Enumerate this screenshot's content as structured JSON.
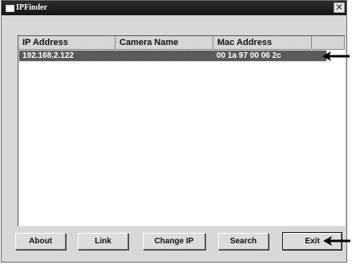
{
  "window": {
    "title": "IPFinder",
    "close_glyph": "✕"
  },
  "list": {
    "columns": [
      "IP Address",
      "Camera Name",
      "Mac Address"
    ],
    "rows": [
      {
        "ip": "192.168.2.122",
        "camera_name": "",
        "mac": "00 1a 97 00 06 2c",
        "selected": true
      }
    ]
  },
  "buttons": {
    "about": "About",
    "link": "Link",
    "change_ip": "Change IP",
    "search": "Search",
    "exit": "Exit"
  },
  "colors": {
    "titlebar": "#1f1f1f",
    "selection": "#5a5a5a",
    "window_bg": "#d8d8d8"
  }
}
